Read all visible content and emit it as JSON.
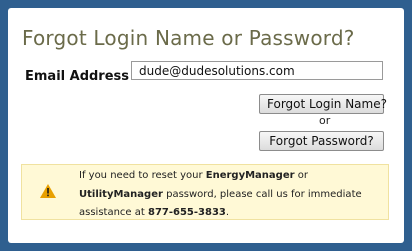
{
  "title": "Forgot Login Name or Password?",
  "email": {
    "label": "Email Address",
    "value": "dude@dudesolutions.com"
  },
  "buttons": {
    "forgot_login": "Forgot Login Name?",
    "or": "or",
    "forgot_password": "Forgot Password?"
  },
  "notice": {
    "icon": "warning-icon",
    "part1": "If you need to reset your ",
    "product1": "EnergyManager",
    "part2": " or ",
    "product2": "UtilityManager",
    "part3": " password, please call us for immediate assistance at ",
    "phone": "877-655-3833",
    "part4": "."
  },
  "colors": {
    "background": "#2f5f8f",
    "title": "#6b6b4a",
    "notice_bg": "#fff9d6",
    "warning": "#e8a000"
  }
}
